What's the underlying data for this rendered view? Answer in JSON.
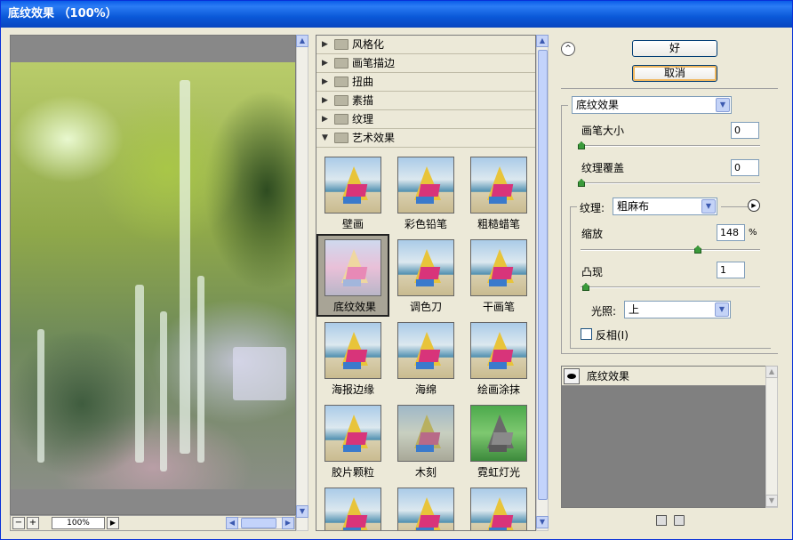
{
  "window": {
    "title": "底纹效果 （100%）"
  },
  "preview": {
    "zoom": "100%",
    "zoom_out": "−",
    "zoom_in": "+"
  },
  "filter_categories": [
    {
      "label": "风格化",
      "expanded": false
    },
    {
      "label": "画笔描边",
      "expanded": false
    },
    {
      "label": "扭曲",
      "expanded": false
    },
    {
      "label": "素描",
      "expanded": false
    },
    {
      "label": "纹理",
      "expanded": false
    },
    {
      "label": "艺术效果",
      "expanded": true
    }
  ],
  "filters": [
    {
      "label": "壁画"
    },
    {
      "label": "彩色铅笔"
    },
    {
      "label": "粗糙蜡笔"
    },
    {
      "label": "底纹效果",
      "selected": true
    },
    {
      "label": "调色刀"
    },
    {
      "label": "干画笔"
    },
    {
      "label": "海报边缘"
    },
    {
      "label": "海绵"
    },
    {
      "label": "绘画涂抹"
    },
    {
      "label": "胶片颗粒"
    },
    {
      "label": "木刻"
    },
    {
      "label": "霓虹灯光"
    },
    {
      "label": ""
    },
    {
      "label": ""
    },
    {
      "label": ""
    }
  ],
  "buttons": {
    "ok": "好",
    "cancel": "取消"
  },
  "settings": {
    "filter_select": "底纹效果",
    "brush_size_label": "画笔大小",
    "brush_size": "0",
    "texture_coverage_label": "纹理覆盖",
    "texture_coverage": "0",
    "texture_label": "纹理:",
    "texture_value": "粗麻布",
    "scaling_label": "缩放",
    "scaling": "148",
    "scaling_unit": "%",
    "relief_label": "凸现",
    "relief": "1",
    "light_label": "光照:",
    "light_value": "上",
    "invert_label": "反相(I)",
    "invert_checked": false
  },
  "layers": [
    {
      "label": "底纹效果"
    }
  ],
  "colors": {
    "titlebar": "#0a58d8",
    "face": "#ece9d8"
  }
}
